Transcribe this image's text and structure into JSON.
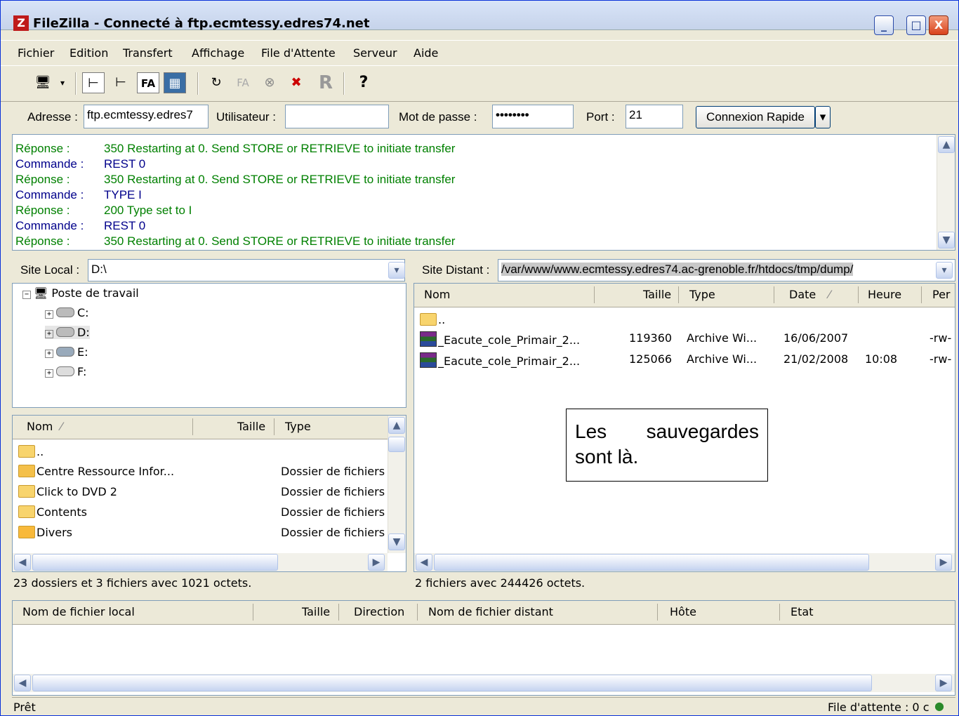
{
  "window": {
    "title": "FileZilla - Connecté à ftp.ecmtessy.edres74.net",
    "app_icon": "Z",
    "buttons": [
      "_",
      "□",
      "X"
    ]
  },
  "menu": [
    "Fichier",
    "Edition",
    "Transfert",
    "Affichage",
    "File d'Attente",
    "Serveur",
    "Aide"
  ],
  "toolbar": {
    "icons": [
      "site-manager-icon",
      "toggle-log-icon",
      "toggle-local-tree-icon",
      "toggle-remote-tree-icon",
      "queue-icon",
      "refresh-icon",
      "process-queue-icon",
      "cancel-icon",
      "disconnect-icon",
      "reconnect-icon",
      "help-icon"
    ],
    "labels": {
      "fa": "FA",
      "fa2": "FA",
      "r": "R",
      "help": "?"
    }
  },
  "quickconnect": {
    "address_label": "Adresse :",
    "address_value": "ftp.ecmtessy.edres7",
    "user_label": "Utilisateur :",
    "user_value": "",
    "password_label": "Mot de passe :",
    "password_value": "••••••••",
    "port_label": "Port :",
    "port_value": "21",
    "button": "Connexion Rapide",
    "dropdown": "▾"
  },
  "log": [
    {
      "k": "Réponse :",
      "v": "350 Restarting at 0. Send STORE or RETRIEVE to initiate transfer",
      "type": "resp"
    },
    {
      "k": "Commande :",
      "v": "REST 0",
      "type": "cmd"
    },
    {
      "k": "Réponse :",
      "v": "350 Restarting at 0. Send STORE or RETRIEVE to initiate transfer",
      "type": "resp"
    },
    {
      "k": "Commande :",
      "v": "TYPE I",
      "type": "cmd"
    },
    {
      "k": "Réponse :",
      "v": "200 Type set to I",
      "type": "resp"
    },
    {
      "k": "Commande :",
      "v": "REST 0",
      "type": "cmd"
    },
    {
      "k": "Réponse :",
      "v": "350 Restarting at 0. Send STORE or RETRIEVE to initiate transfer",
      "type": "resp"
    }
  ],
  "local": {
    "site_label": "Site Local :",
    "site_value": "D:\\",
    "tree": {
      "root": "Poste de travail",
      "drives": [
        "C:",
        "D:",
        "E:",
        "F:"
      ]
    },
    "columns": [
      "Nom",
      "Taille",
      "Type"
    ],
    "files": [
      {
        "name": "..",
        "type": ""
      },
      {
        "name": "Centre Ressource Infor...",
        "type": "Dossier de fichiers"
      },
      {
        "name": "Click to DVD 2",
        "type": "Dossier de fichiers"
      },
      {
        "name": "Contents",
        "type": "Dossier de fichiers"
      },
      {
        "name": "Divers",
        "type": "Dossier de fichiers"
      }
    ],
    "status": "23 dossiers et 3 fichiers avec 1021 octets."
  },
  "remote": {
    "site_label": "Site Distant :",
    "site_value": "/var/www/www.ecmtessy.edres74.ac-grenoble.fr/htdocs/tmp/dump/",
    "columns": [
      "Nom",
      "Taille",
      "Type",
      "Date",
      "Heure",
      "Per"
    ],
    "files": [
      {
        "name": "..",
        "size": "",
        "type": "",
        "date": "",
        "time": "",
        "perm": ""
      },
      {
        "name": "_Eacute_cole_Primair_2...",
        "size": "119360",
        "type": "Archive Wi...",
        "date": "16/06/2007",
        "time": "",
        "perm": "-rw-"
      },
      {
        "name": "_Eacute_cole_Primair_2...",
        "size": "125066",
        "type": "Archive Wi...",
        "date": "21/02/2008",
        "time": "10:08",
        "perm": "-rw-"
      }
    ],
    "status": "2 fichiers avec 244426 octets."
  },
  "queue": {
    "columns": [
      "Nom de fichier local",
      "Taille",
      "Direction",
      "Nom de fichier distant",
      "Hôte",
      "Etat"
    ]
  },
  "statusbar": {
    "left": "Prêt",
    "right": "File d'attente : 0 c"
  },
  "annotation": "Les sauvegardes sont là."
}
